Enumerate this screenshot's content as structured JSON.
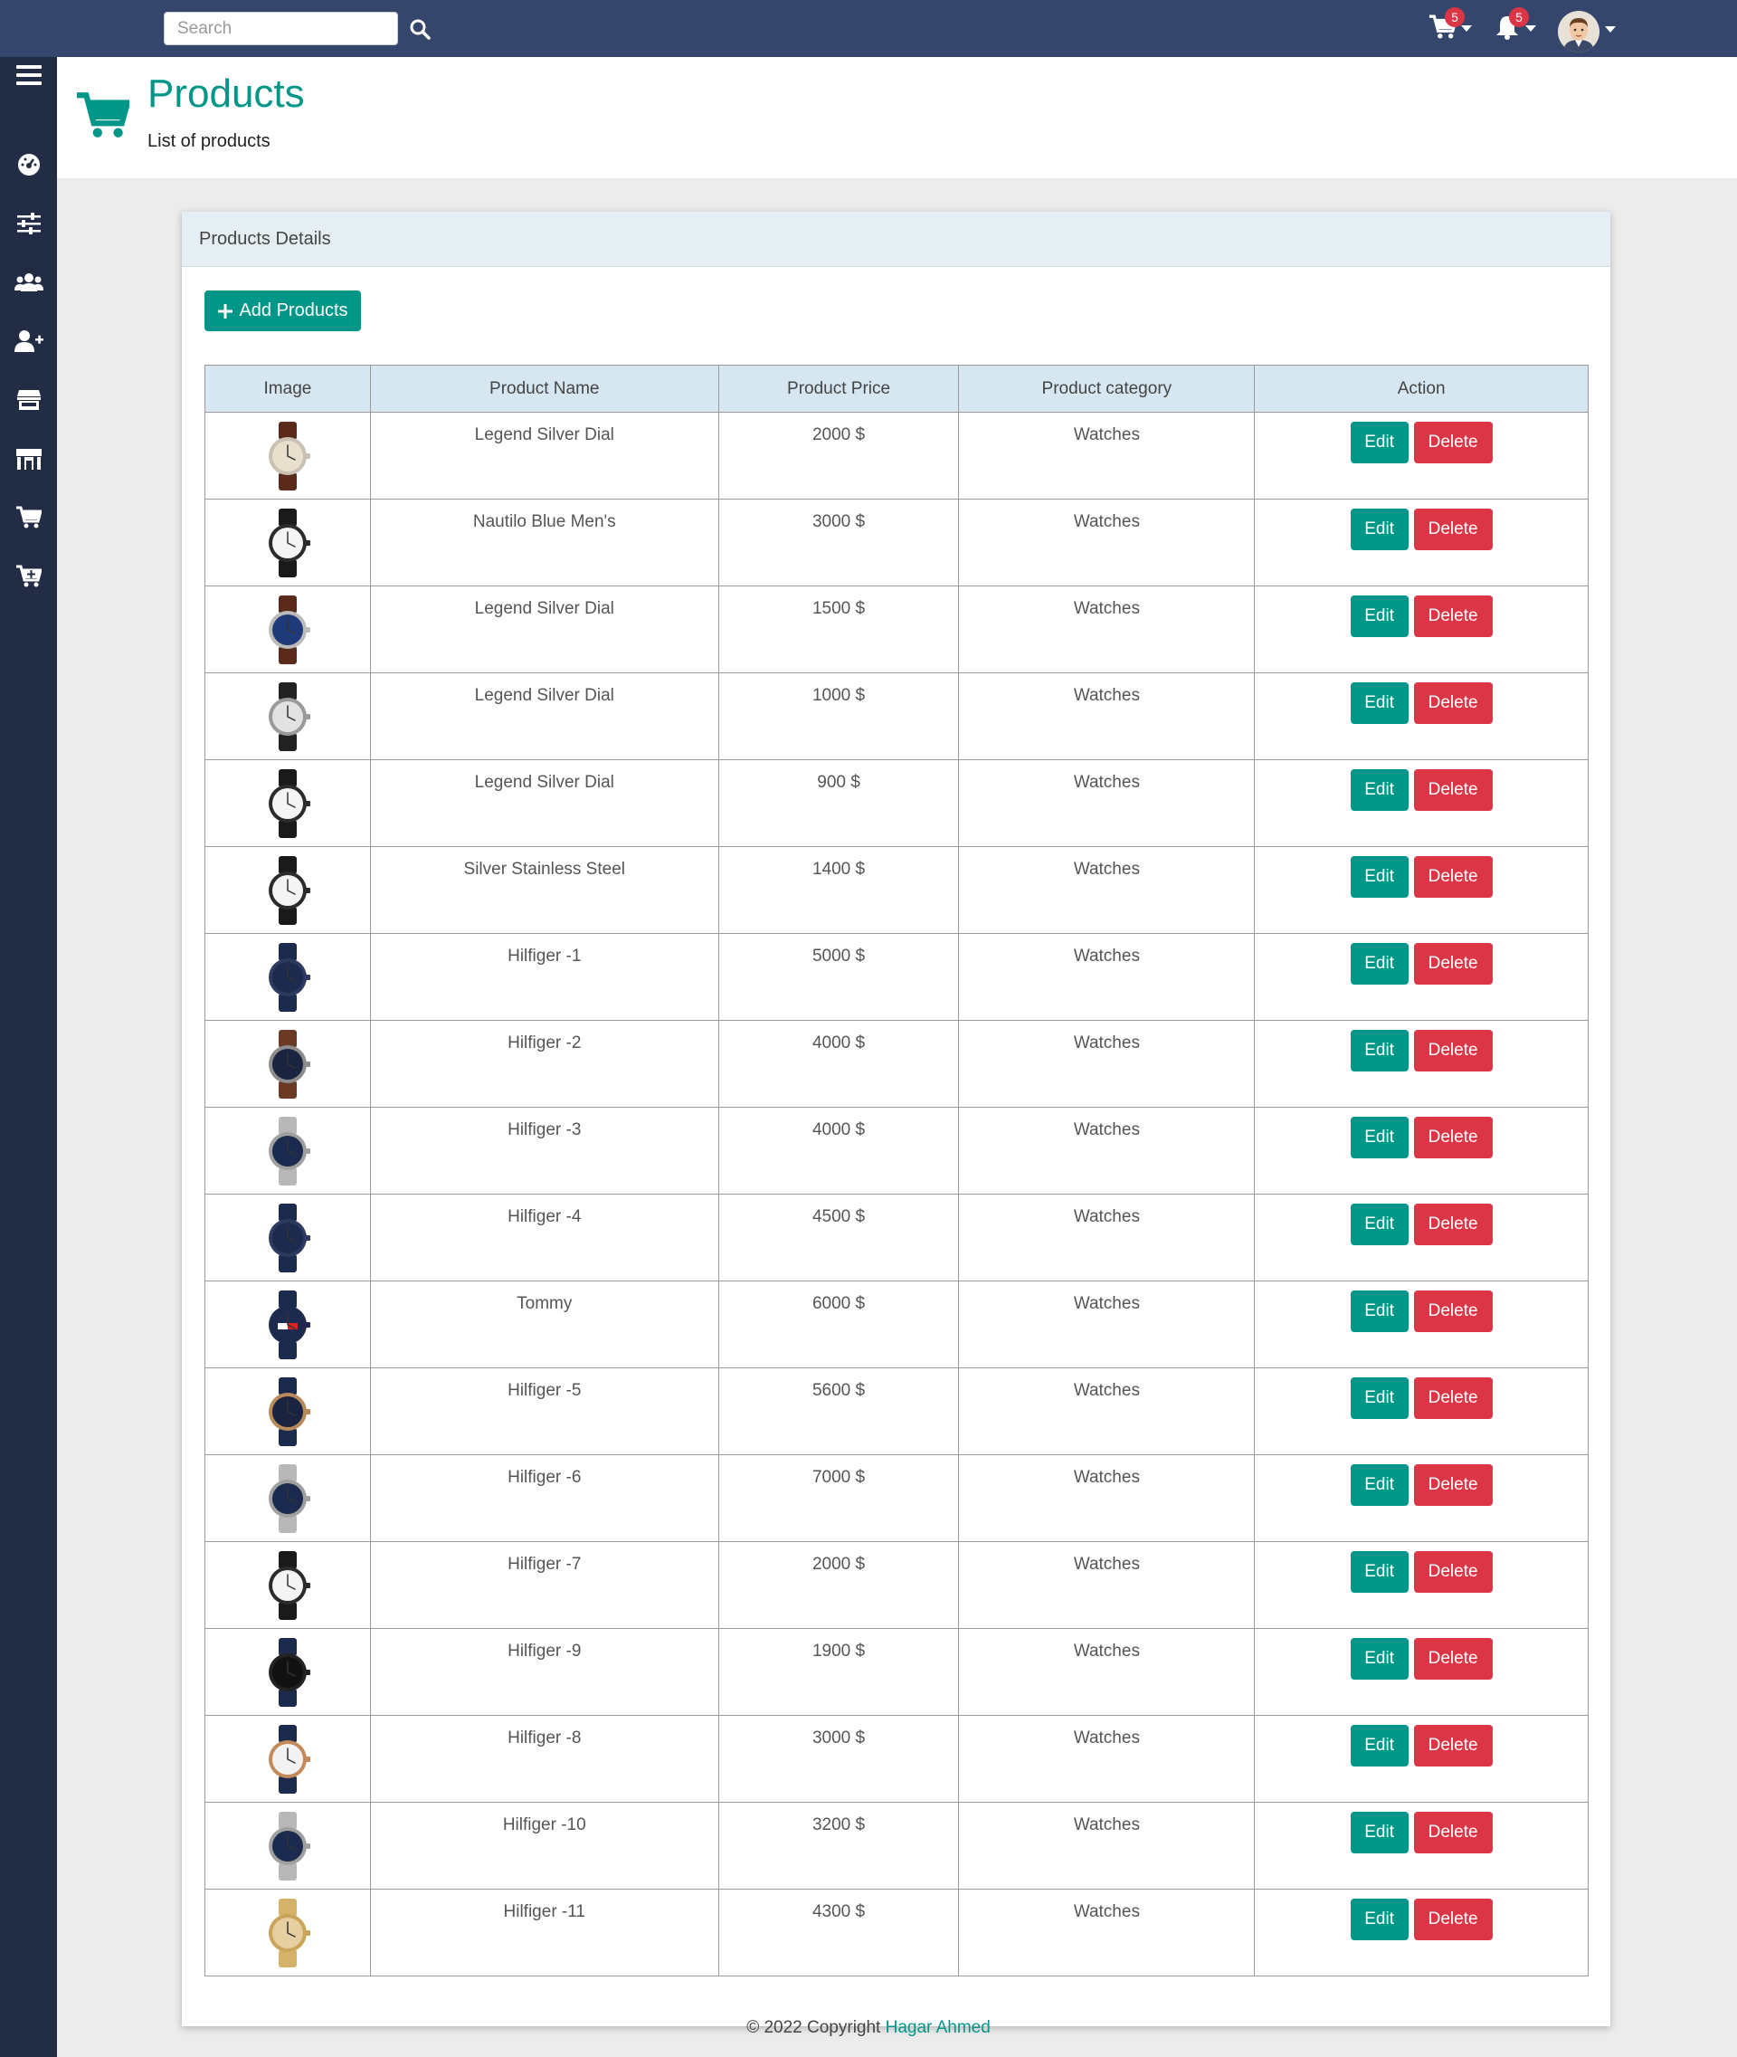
{
  "topbar": {
    "search_placeholder": "Search",
    "cart_badge": "5",
    "notification_badge": "5"
  },
  "sidebar": {
    "items": [
      "menu-icon",
      "dashboard-icon",
      "sliders-icon",
      "users-icon",
      "user-plus-icon",
      "store-icon",
      "shop-icon",
      "cart-icon",
      "cart-plus-icon"
    ]
  },
  "header": {
    "title": "Products",
    "subtitle": "List of products"
  },
  "card": {
    "title": "Products Details",
    "add_button": "Add Products"
  },
  "table": {
    "columns": [
      "Image",
      "Product Name",
      "Product Price",
      "Product category",
      "Action"
    ],
    "edit_label": "Edit",
    "delete_label": "Delete",
    "rows": [
      {
        "name": "Legend Silver Dial",
        "price": "2000 $",
        "category": "Watches",
        "watch_style": "brown-cream"
      },
      {
        "name": "Nautilo Blue Men's",
        "price": "3000 $",
        "category": "Watches",
        "watch_style": "black-white"
      },
      {
        "name": "Legend Silver Dial",
        "price": "1500 $",
        "category": "Watches",
        "watch_style": "brown-blue"
      },
      {
        "name": "Legend Silver Dial",
        "price": "1000 $",
        "category": "Watches",
        "watch_style": "black-silver"
      },
      {
        "name": "Legend Silver Dial",
        "price": "900 $",
        "category": "Watches",
        "watch_style": "black-white"
      },
      {
        "name": "Silver Stainless Steel",
        "price": "1400 $",
        "category": "Watches",
        "watch_style": "black-white"
      },
      {
        "name": "Hilfiger -1",
        "price": "5000 $",
        "category": "Watches",
        "watch_style": "navy-navy"
      },
      {
        "name": "Hilfiger -2",
        "price": "4000 $",
        "category": "Watches",
        "watch_style": "brown-navy"
      },
      {
        "name": "Hilfiger -3",
        "price": "4000 $",
        "category": "Watches",
        "watch_style": "steel-navy"
      },
      {
        "name": "Hilfiger -4",
        "price": "4500 $",
        "category": "Watches",
        "watch_style": "navy-navy"
      },
      {
        "name": "Tommy",
        "price": "6000 $",
        "category": "Watches",
        "watch_style": "tommy"
      },
      {
        "name": "Hilfiger -5",
        "price": "5600 $",
        "category": "Watches",
        "watch_style": "navy-gold"
      },
      {
        "name": "Hilfiger -6",
        "price": "7000 $",
        "category": "Watches",
        "watch_style": "steel-navy"
      },
      {
        "name": "Hilfiger -7",
        "price": "2000 $",
        "category": "Watches",
        "watch_style": "black-white"
      },
      {
        "name": "Hilfiger -9",
        "price": "1900 $",
        "category": "Watches",
        "watch_style": "navy-black"
      },
      {
        "name": "Hilfiger -8",
        "price": "3000 $",
        "category": "Watches",
        "watch_style": "navy-white"
      },
      {
        "name": "Hilfiger -10",
        "price": "3200 $",
        "category": "Watches",
        "watch_style": "steel-navy"
      },
      {
        "name": "Hilfiger -11",
        "price": "4300 $",
        "category": "Watches",
        "watch_style": "gold-gold"
      }
    ]
  },
  "footer": {
    "copyright": "© 2022 Copyright",
    "author": "Hagar Ahmed"
  },
  "colors": {
    "accent": "#009688",
    "danger": "#dc3545",
    "topbar": "#34466b",
    "sidebar": "#222d45"
  }
}
